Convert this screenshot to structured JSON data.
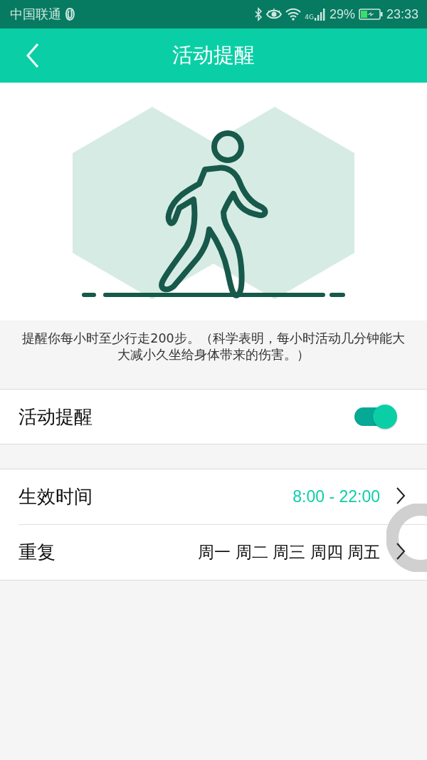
{
  "status_bar": {
    "carrier": "中国联通",
    "network_type": "4G",
    "battery_percent": "29%",
    "time": "23:33"
  },
  "header": {
    "title": "活动提醒"
  },
  "description": "提醒你每小时至少行走200步。（科学表明，每小时活动几分钟能大大减小久坐给身体带来的伤害。）",
  "toggle": {
    "label": "活动提醒",
    "on": true
  },
  "settings": [
    {
      "label": "生效时间",
      "value": "8:00 - 22:00",
      "kind": "accent"
    },
    {
      "label": "重复",
      "value": "周一 周二 周三 周四 周五",
      "kind": "plain"
    }
  ]
}
